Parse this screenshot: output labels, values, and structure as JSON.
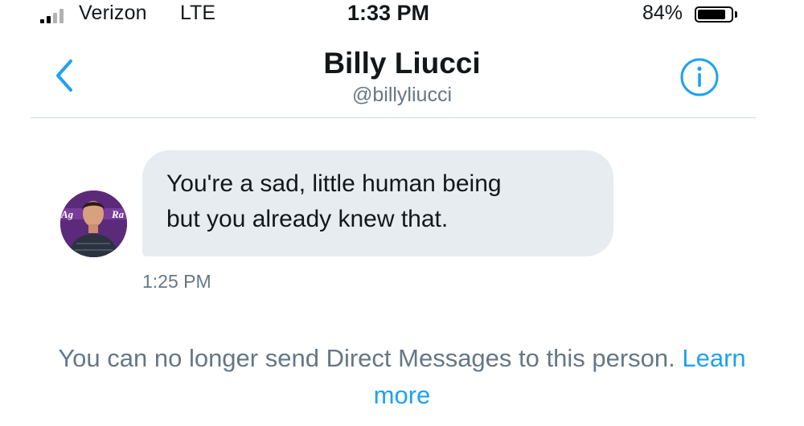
{
  "status_bar": {
    "carrier": "Verizon",
    "network": "LTE",
    "time": "1:33 PM",
    "battery_percent": "84%",
    "battery_level": 0.84,
    "signal_bars_filled": 2,
    "signal_bars_total": 4
  },
  "header": {
    "back_icon": "chevron-left-icon",
    "name": "Billy Liucci",
    "handle": "@billyliucci",
    "info_icon": "info-icon"
  },
  "conversation": {
    "messages": [
      {
        "text": "You're a sad, little human being\nbut you already knew that.",
        "timestamp": "1:25 PM",
        "avatar_text_left": "Ag",
        "avatar_text_right": "Ra"
      }
    ]
  },
  "notice": {
    "text": "You can no longer send Direct Messages to this person.",
    "link": "Learn more"
  },
  "colors": {
    "accent": "#1da1f2",
    "bubble": "#e6ecf0",
    "secondary_text": "#657786"
  }
}
